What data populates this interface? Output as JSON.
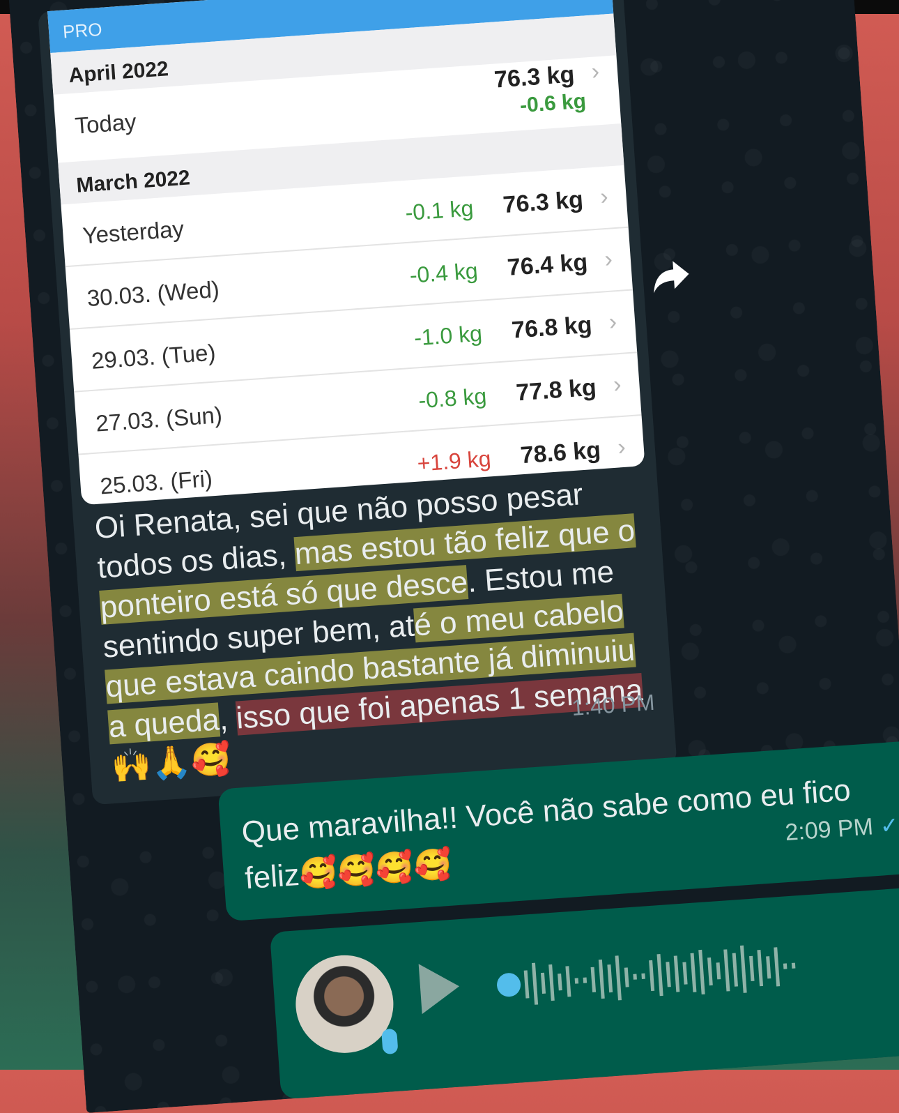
{
  "weight_log": {
    "banner": "PRO",
    "april": {
      "header": "April 2022",
      "entry": {
        "label": "Today",
        "change": "-0.6 kg",
        "weight": "76.3 kg"
      }
    },
    "march": {
      "header": "March 2022",
      "entries": [
        {
          "label": "Yesterday",
          "change": "-0.1 kg",
          "weight": "76.3 kg",
          "trend": "down"
        },
        {
          "label": "30.03. (Wed)",
          "change": "-0.4 kg",
          "weight": "76.4 kg",
          "trend": "down"
        },
        {
          "label": "29.03. (Tue)",
          "change": "-1.0 kg",
          "weight": "76.8 kg",
          "trend": "down"
        },
        {
          "label": "27.03. (Sun)",
          "change": "-0.8 kg",
          "weight": "77.8 kg",
          "trend": "down"
        },
        {
          "label": "25.03. (Fri)",
          "change": "+1.9 kg",
          "weight": "78.6 kg",
          "trend": "up"
        }
      ]
    },
    "chevron": "›"
  },
  "incoming_message": {
    "parts": [
      "Oi Renata, sei que não posso pesar todos os dias, ",
      "mas estou tão feliz que o ponteiro está só que desce",
      ". Estou me sentindo super bem, at",
      "é o meu cabelo que estava caindo bastante já diminuiu a queda",
      ", ",
      "isso que foi apenas 1 semana",
      " 🙌🙏🥰"
    ],
    "time": "1:40 PM"
  },
  "outgoing_message": {
    "text": "Que maravilha!! Você não sabe como eu fico feliz🥰🥰🥰🥰",
    "time": "2:09 PM",
    "ticks": "✓✓"
  },
  "colors": {
    "chat_bg": "#121b22",
    "incoming_bubble": "#1f2c33",
    "outgoing_bubble": "#005c4b",
    "loss_green": "#3a9a3e",
    "gain_red": "#d8453d",
    "highlight_yellow": "#d8d448",
    "highlight_red": "#c44246",
    "read_tick_blue": "#53bdeb"
  },
  "icons": [
    "forward-arrow-icon",
    "chevron-right-icon",
    "play-icon",
    "mic-icon",
    "double-check-icon"
  ]
}
